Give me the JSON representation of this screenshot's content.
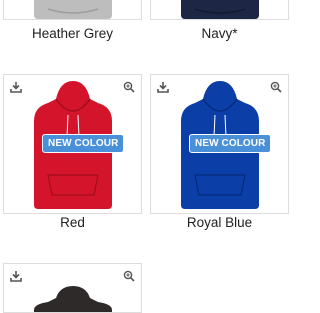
{
  "products": [
    {
      "name": "Heather Grey",
      "color": "#bdbdbd"
    },
    {
      "name": "Navy*",
      "color": "#1d2745"
    },
    {
      "name": "Red",
      "color": "#d4142a",
      "badge": "NEW COLOUR"
    },
    {
      "name": "Royal Blue",
      "color": "#0b3ea6",
      "badge": "NEW COLOUR"
    },
    {
      "name": "",
      "color": "#2e2a29"
    }
  ],
  "icons": {
    "download": "download-icon",
    "zoom": "zoom-icon"
  },
  "colors": {
    "badge_bg": "#4a90d8",
    "card_border": "#dddddd",
    "icon": "#555555"
  }
}
